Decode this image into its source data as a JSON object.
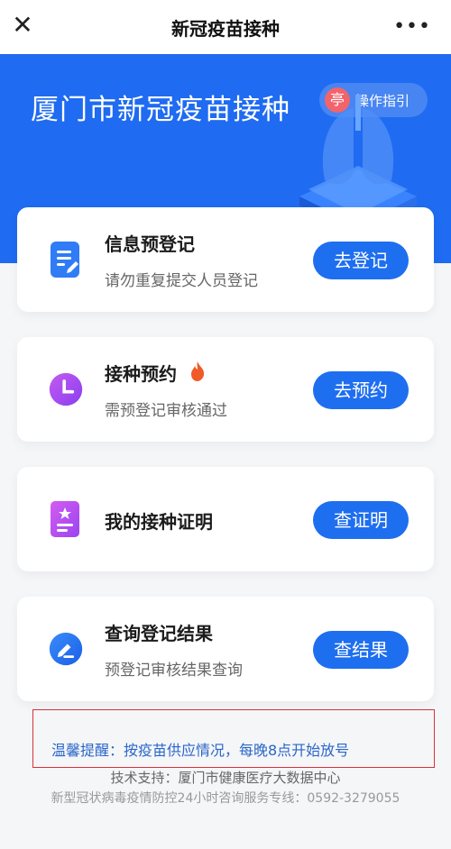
{
  "topbar": {
    "title": "新冠疫苗接种",
    "close_icon": "close-icon",
    "more_icon": "more-icon"
  },
  "hero": {
    "heading": "厦门市新冠疫苗接种",
    "guide_label": "操作指引",
    "guide_glyph": "亭"
  },
  "cards": [
    {
      "title": "信息预登记",
      "subtitle": "请勿重复提交人员登记",
      "button": "去登记",
      "icon": "edit-document-icon"
    },
    {
      "title": "接种预约",
      "subtitle": "需预登记审核通过",
      "button": "去预约",
      "icon": "clock-icon",
      "badge_icon": "flame-icon"
    },
    {
      "title": "我的接种证明",
      "button": "查证明",
      "icon": "certificate-icon"
    },
    {
      "title": "查询登记结果",
      "subtitle": "预登记审核结果查询",
      "button": "查结果",
      "icon": "pen-icon"
    }
  ],
  "notice": "温馨提醒：按疫苗供应情况，每晚8点开始放号",
  "footer": {
    "support": "技术支持：厦门市健康医疗大数据中心",
    "hotline": "新型冠状病毒疫情防控24小时咨询服务专线：0592-3279055"
  },
  "colors": {
    "primary": "#1f6bf1",
    "button": "#1e6ef0",
    "notice_text": "#2a66c8",
    "notice_border": "#d8323a"
  }
}
